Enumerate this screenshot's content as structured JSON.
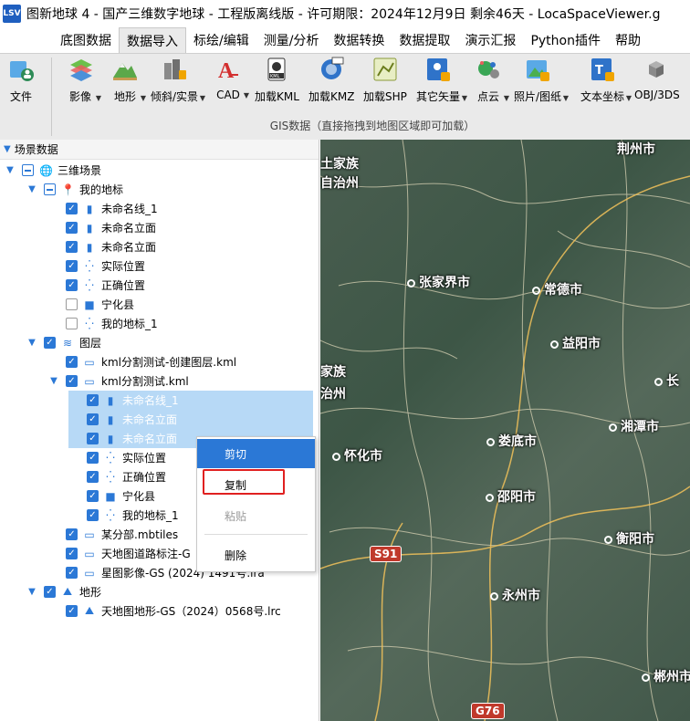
{
  "window": {
    "app_icon_text": "LSV",
    "title": "图新地球 4 - 国产三维数字地球 - 工程版离线版 - 许可期限：2024年12月9日 剩余46天 - LocaSpaceViewer.g"
  },
  "menu": {
    "tabs": [
      "底图数据",
      "数据导入",
      "标绘/编辑",
      "测量/分析",
      "数据转换",
      "数据提取",
      "演示汇报",
      "Python插件",
      "帮助"
    ],
    "active_index": 1
  },
  "ribbon": {
    "file_label": "文件",
    "group_label": "GIS数据（直接拖拽到地图区域即可加载）",
    "buttons": [
      {
        "label": "影像",
        "icon": "imagery-icon",
        "has_dropdown": true
      },
      {
        "label": "地形",
        "icon": "terrain-icon",
        "has_dropdown": true
      },
      {
        "label": "倾斜/实景",
        "icon": "oblique-model-icon",
        "has_dropdown": true
      },
      {
        "label": "CAD",
        "icon": "cad-icon",
        "has_dropdown": true
      },
      {
        "label": "加载KML",
        "icon": "kml-icon",
        "has_dropdown": false
      },
      {
        "label": "加载KMZ",
        "icon": "kmz-icon",
        "has_dropdown": false
      },
      {
        "label": "加载SHP",
        "icon": "shp-icon",
        "has_dropdown": false
      },
      {
        "label": "其它矢量",
        "icon": "vector-icon",
        "has_dropdown": true
      },
      {
        "label": "点云",
        "icon": "point-cloud-icon",
        "has_dropdown": true
      },
      {
        "label": "照片/图纸",
        "icon": "photo-icon",
        "has_dropdown": true
      },
      {
        "label": "文本坐标",
        "icon": "text-coordinate-icon",
        "has_dropdown": true
      },
      {
        "label": "OBJ/3DS",
        "icon": "obj-3ds-icon",
        "has_dropdown": false
      }
    ]
  },
  "panel": {
    "title": "场景数据",
    "tree": [
      {
        "text": "三维场景",
        "icon": "globe-icon",
        "check": "partial",
        "expand": "open",
        "level": 0
      },
      {
        "text": "我的地标",
        "icon": "placemark-icon",
        "check": "partial",
        "expand": "open",
        "level": 1
      },
      {
        "text": "未命名线_1",
        "icon": "chart-bar-icon",
        "check": "on",
        "expand": "none",
        "level": 2
      },
      {
        "text": "未命名立面",
        "icon": "chart-bar-icon",
        "check": "on",
        "expand": "none",
        "level": 2
      },
      {
        "text": "未命名立面",
        "icon": "chart-bar-icon",
        "check": "on",
        "expand": "none",
        "level": 2
      },
      {
        "text": "实际位置",
        "icon": "points-icon",
        "check": "on",
        "expand": "none",
        "level": 2
      },
      {
        "text": "正确位置",
        "icon": "points-icon",
        "check": "on",
        "expand": "none",
        "level": 2
      },
      {
        "text": "宁化县",
        "icon": "polygon-icon",
        "check": "off",
        "expand": "none",
        "level": 2
      },
      {
        "text": "我的地标_1",
        "icon": "points-icon",
        "check": "off",
        "expand": "none",
        "level": 2
      },
      {
        "text": "图层",
        "icon": "layers-icon",
        "check": "on",
        "expand": "open",
        "level": 1
      },
      {
        "text": "kml分割测试-创建图层.kml",
        "icon": "monitor-icon",
        "check": "on",
        "expand": "none",
        "level": 2
      },
      {
        "text": "kml分割测试.kml",
        "icon": "monitor-icon",
        "check": "on",
        "expand": "open",
        "level": 2
      },
      {
        "text": "未命名线_1",
        "icon": "chart-bar-icon",
        "check": "on",
        "expand": "none",
        "level": 3,
        "selected": true
      },
      {
        "text": "未命名立面",
        "icon": "chart-bar-icon",
        "check": "on",
        "expand": "none",
        "level": 3,
        "selected": true
      },
      {
        "text": "未命名立面",
        "icon": "chart-bar-icon",
        "check": "on",
        "expand": "none",
        "level": 3,
        "selected": true
      },
      {
        "text": "实际位置",
        "icon": "points-icon",
        "check": "on",
        "expand": "none",
        "level": 3
      },
      {
        "text": "正确位置",
        "icon": "points-icon",
        "check": "on",
        "expand": "none",
        "level": 3
      },
      {
        "text": "宁化县",
        "icon": "polygon-icon",
        "check": "on",
        "expand": "none",
        "level": 3
      },
      {
        "text": "我的地标_1",
        "icon": "points-icon",
        "check": "on",
        "expand": "none",
        "level": 3
      },
      {
        "text": "某分部.mbtiles",
        "icon": "monitor-icon",
        "check": "on",
        "expand": "none",
        "level": 2
      },
      {
        "text": "天地图道路标注-G",
        "icon": "monitor-icon",
        "check": "on",
        "expand": "none",
        "level": 2
      },
      {
        "text": "星图影像-GS (2024) 1491号.lra",
        "icon": "monitor-icon",
        "check": "on",
        "expand": "none",
        "level": 2
      },
      {
        "text": "地形",
        "icon": "terrain-layer-icon",
        "check": "on",
        "expand": "open",
        "level": 1
      },
      {
        "text": "天地图地形-GS（2024）0568号.lrc",
        "icon": "terrain-layer-icon",
        "check": "on",
        "expand": "none",
        "level": 2
      }
    ]
  },
  "context_menu": {
    "items": [
      {
        "label": "剪切",
        "state": "hover"
      },
      {
        "label": "复制",
        "state": "highlighted"
      },
      {
        "label": "粘贴",
        "state": "disabled"
      },
      {
        "label": "删除",
        "state": "normal"
      }
    ]
  },
  "map": {
    "labels": [
      {
        "text": "荆州市",
        "dot": false
      },
      {
        "text": "土家族",
        "dot": false
      },
      {
        "text": "自治州",
        "dot": false
      },
      {
        "text": "张家界市",
        "dot": true
      },
      {
        "text": "常德市",
        "dot": true
      },
      {
        "text": "益阳市",
        "dot": true
      },
      {
        "text": "家族",
        "dot": false
      },
      {
        "text": "治州",
        "dot": false
      },
      {
        "text": "长",
        "dot": true
      },
      {
        "text": "湘潭市",
        "dot": true
      },
      {
        "text": "娄底市",
        "dot": true
      },
      {
        "text": "怀化市",
        "dot": true
      },
      {
        "text": "邵阳市",
        "dot": true
      },
      {
        "text": "衡阳市",
        "dot": true
      },
      {
        "text": "永州市",
        "dot": true
      },
      {
        "text": "郴州市",
        "dot": true
      }
    ],
    "shields": [
      "S91",
      "G76"
    ]
  }
}
